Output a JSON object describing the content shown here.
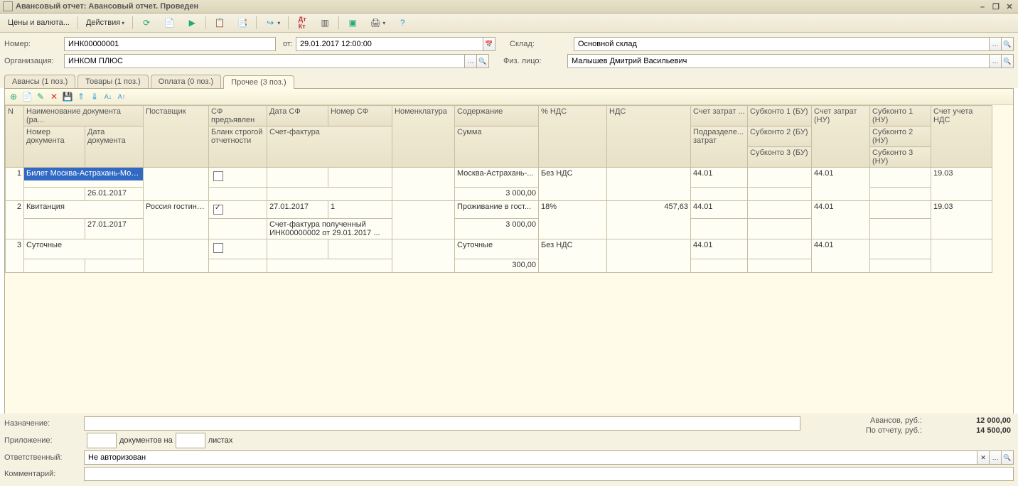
{
  "window_title": "Авансовый отчет: Авансовый отчет. Проведен",
  "toolbar": {
    "prices_currency": "Цены и валюта...",
    "actions": "Действия"
  },
  "header": {
    "number_label": "Номер:",
    "number": "ИНК00000001",
    "date_label": "от:",
    "date": "29.01.2017 12:00:00",
    "warehouse_label": "Склад:",
    "warehouse": "Основной склад",
    "org_label": "Организация:",
    "org": "ИНКОМ ПЛЮС",
    "person_label": "Физ. лицо:",
    "person": "Малышев Дмитрий Васильевич"
  },
  "tabs": {
    "t1": "Авансы (1 поз.)",
    "t2": "Товары (1 поз.)",
    "t3": "Оплата (0 поз.)",
    "t4": "Прочее (3 поз.)"
  },
  "cols": {
    "n": "N",
    "docname": "Наименование документа (ра...",
    "docnum": "Номер документа",
    "docdate": "Дата документа",
    "supplier": "Поставщик",
    "sf": "СФ предъявлен",
    "strict": "Бланк строгой отчетности",
    "sfdate": "Дата СФ",
    "sfnum": "Номер СФ",
    "invoice": "Счет-фактура",
    "nomen": "Номенклатура",
    "content": "Содержание",
    "sum": "Сумма",
    "vat": "% НДС",
    "vatamt": "НДС",
    "acct_bu": "Счет затрат ...",
    "subdiv": "Подразделе... затрат",
    "sub1bu": "Субконто 1 (БУ)",
    "sub2bu": "Субконто 2 (БУ)",
    "sub3bu": "Субконто 3 (БУ)",
    "acct_nu": "Счет затрат (НУ)",
    "sub1nu": "Субконто 1 (НУ)",
    "sub2nu": "Субконто 2 (НУ)",
    "sub3nu": "Субконто 3 (НУ)",
    "acct_vat": "Счет учета НДС"
  },
  "rows": [
    {
      "n": "1",
      "docname": "Билет Москва-Астрахань-Мос...",
      "docdate": "26.01.2017",
      "supplier": "",
      "sf": false,
      "sfdate": "",
      "sfnum": "",
      "invoice": "",
      "content": "Москва-Астрахань-...",
      "sum": "3 000,00",
      "vat": "Без НДС",
      "vatamt": "",
      "acct_bu": "44.01",
      "acct_nu": "44.01",
      "acct_vat": "19.03"
    },
    {
      "n": "2",
      "docname": "Квитанция",
      "docdate": "27.01.2017",
      "supplier": "Россия гостиница",
      "sf": true,
      "sfdate": "27.01.2017",
      "sfnum": "1",
      "invoice": "Счет-фактура полученный ИНК00000002 от 29.01.2017 ...",
      "content": "Проживание в гост...",
      "sum": "3 000,00",
      "vat": "18%",
      "vatamt": "457,63",
      "acct_bu": "44.01",
      "acct_nu": "44.01",
      "acct_vat": "19.03"
    },
    {
      "n": "3",
      "docname": "Суточные",
      "docdate": "",
      "supplier": "",
      "sf": false,
      "sfdate": "",
      "sfnum": "",
      "invoice": "",
      "content": "Суточные",
      "sum": "300,00",
      "vat": "Без НДС",
      "vatamt": "",
      "acct_bu": "44.01",
      "acct_nu": "44.01",
      "acct_vat": ""
    }
  ],
  "footer": {
    "purpose_label": "Назначение:",
    "purpose": "",
    "attach_label": "Приложение:",
    "attach_text1": "документов на",
    "attach_text2": "листах",
    "resp_label": "Ответственный:",
    "resp": "Не авторизован",
    "comment_label": "Комментарий:",
    "totals": {
      "adv_label": "Авансов, руб.:",
      "adv": "12 000,00",
      "rep_label": "По отчету, руб.:",
      "rep": "14 500,00"
    }
  }
}
